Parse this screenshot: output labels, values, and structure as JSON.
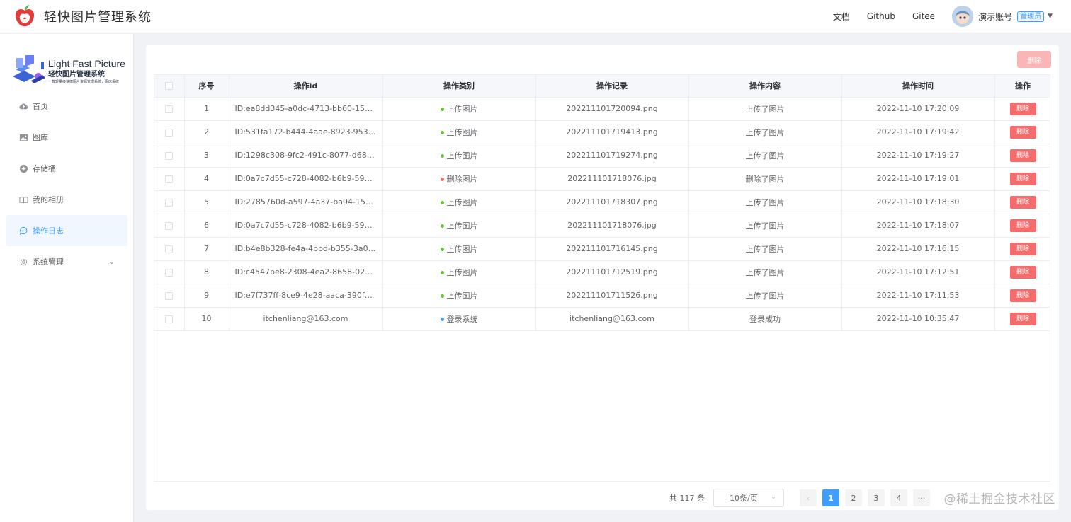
{
  "header": {
    "title": "轻快图片管理系统",
    "links": [
      "文档",
      "Github",
      "Gitee"
    ],
    "user_name": "演示账号",
    "role": "管理员"
  },
  "sidebar": {
    "logo_en": "Light Fast Picture",
    "logo_cn": "轻快图片管理系统",
    "logo_sub": "一款轻量级快捷图片资源管理系统，图床系统",
    "items": [
      {
        "label": "首页",
        "icon": "cloud-icon"
      },
      {
        "label": "图库",
        "icon": "picture-icon"
      },
      {
        "label": "存储桶",
        "icon": "plus-circle-icon"
      },
      {
        "label": "我的相册",
        "icon": "album-icon"
      },
      {
        "label": "操作日志",
        "icon": "chat-icon",
        "active": true
      },
      {
        "label": "系统管理",
        "icon": "gear-icon",
        "has_children": true
      }
    ]
  },
  "toolbar": {
    "delete_label": "删除"
  },
  "table": {
    "columns": [
      "序号",
      "操作id",
      "操作类别",
      "操作记录",
      "操作内容",
      "操作时间",
      "操作"
    ],
    "rows": [
      {
        "no": "1",
        "id": "ID:ea8dd345-a0dc-4713-bb60-155...",
        "type": "上传图片",
        "type_color": "#67c23a",
        "record": "202211101720094.png",
        "content": "上传了图片",
        "time": "2022-11-10 17:20:09",
        "action": "删除"
      },
      {
        "no": "2",
        "id": "ID:531fa172-b444-4aae-8923-9539...",
        "type": "上传图片",
        "type_color": "#67c23a",
        "record": "202211101719413.png",
        "content": "上传了图片",
        "time": "2022-11-10 17:19:42",
        "action": "删除"
      },
      {
        "no": "3",
        "id": "ID:1298c308-9fc2-491c-8077-d68b...",
        "type": "上传图片",
        "type_color": "#67c23a",
        "record": "202211101719274.png",
        "content": "上传了图片",
        "time": "2022-11-10 17:19:27",
        "action": "删除"
      },
      {
        "no": "4",
        "id": "ID:0a7c7d55-c728-4082-b6b9-5980...",
        "type": "删除图片",
        "type_color": "#f56c6c",
        "record": "202211101718076.jpg",
        "content": "删除了图片",
        "time": "2022-11-10 17:19:01",
        "action": "删除"
      },
      {
        "no": "5",
        "id": "ID:2785760d-a597-4a37-ba94-155e...",
        "type": "上传图片",
        "type_color": "#67c23a",
        "record": "202211101718307.png",
        "content": "上传了图片",
        "time": "2022-11-10 17:18:30",
        "action": "删除"
      },
      {
        "no": "6",
        "id": "ID:0a7c7d55-c728-4082-b6b9-5980...",
        "type": "上传图片",
        "type_color": "#67c23a",
        "record": "202211101718076.jpg",
        "content": "上传了图片",
        "time": "2022-11-10 17:18:07",
        "action": "删除"
      },
      {
        "no": "7",
        "id": "ID:b4e8b328-fe4a-4bbd-b355-3a0e...",
        "type": "上传图片",
        "type_color": "#67c23a",
        "record": "202211101716145.png",
        "content": "上传了图片",
        "time": "2022-11-10 17:16:15",
        "action": "删除"
      },
      {
        "no": "8",
        "id": "ID:c4547be8-2308-4ea2-8658-0231...",
        "type": "上传图片",
        "type_color": "#67c23a",
        "record": "202211101712519.png",
        "content": "上传了图片",
        "time": "2022-11-10 17:12:51",
        "action": "删除"
      },
      {
        "no": "9",
        "id": "ID:e7f737ff-8ce9-4e28-aaca-390f02...",
        "type": "上传图片",
        "type_color": "#67c23a",
        "record": "202211101711526.png",
        "content": "上传了图片",
        "time": "2022-11-10 17:11:53",
        "action": "删除"
      },
      {
        "no": "10",
        "id": "itchenliang@163.com",
        "type": "登录系统",
        "type_color": "#409eff",
        "record": "itchenliang@163.com",
        "content": "登录成功",
        "time": "2022-11-10 10:35:47",
        "action": "删除"
      }
    ]
  },
  "pagination": {
    "total": "共 117 条",
    "page_size": "10条/页",
    "prev": "‹",
    "pages": [
      "1",
      "2",
      "3",
      "4"
    ],
    "current": "1",
    "more": "···"
  },
  "watermark": "@稀土掘金技术社区"
}
